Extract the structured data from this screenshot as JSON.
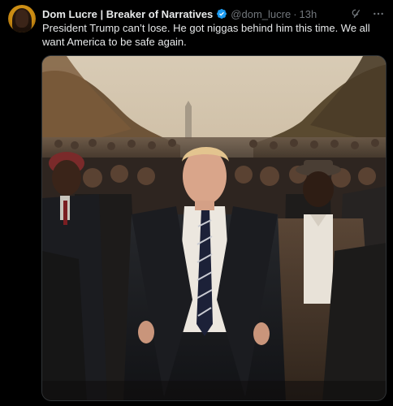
{
  "tweet": {
    "author": {
      "display_name": "Dom Lucre | Breaker of Narratives",
      "handle": "@dom_lucre",
      "verified": true,
      "verified_color": "#1d9bf0",
      "avatar_icon": "user-avatar"
    },
    "separator": "·",
    "timestamp": "13h",
    "text": "President Trump can’t lose. He got niggas behind him this time. We all want America to be safe again.",
    "actions": {
      "grok_icon": "grok-icon",
      "more_icon": "more-options-icon"
    },
    "media": {
      "type": "image"
    }
  },
  "theme": {
    "background": "#000000",
    "text_primary": "#e7e9ea",
    "text_secondary": "#71767b",
    "border": "#2f3336"
  }
}
